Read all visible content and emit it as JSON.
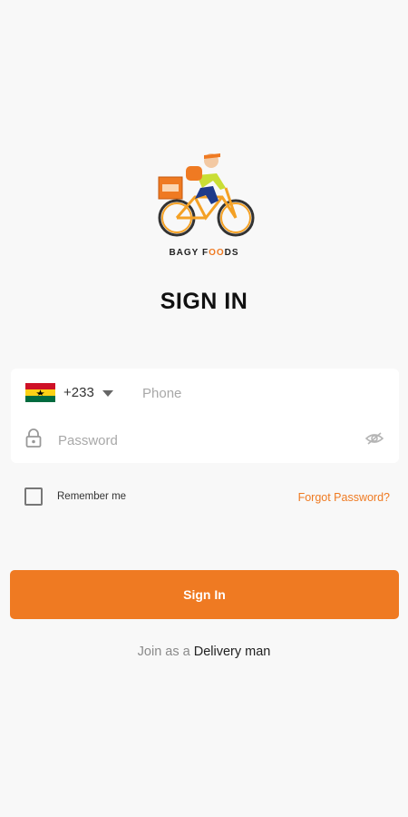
{
  "logo": {
    "icon": "delivery-bike-icon",
    "brand_prefix": "BAGY F",
    "brand_accent": "OO",
    "brand_suffix": "DS"
  },
  "page": {
    "title": "SIGN IN"
  },
  "login_form": {
    "country_flag": "ghana-flag-icon",
    "country_code": "+233",
    "phone_placeholder": "Phone",
    "password_placeholder": "Password"
  },
  "options": {
    "remember_label": "Remember me",
    "forgot_label": "Forgot Password?"
  },
  "actions": {
    "signin_label": "Sign In"
  },
  "footer": {
    "join_prefix": "Join as a",
    "join_link": "Delivery man"
  },
  "colors": {
    "accent": "#ef7a22",
    "background": "#f8f8f8"
  }
}
